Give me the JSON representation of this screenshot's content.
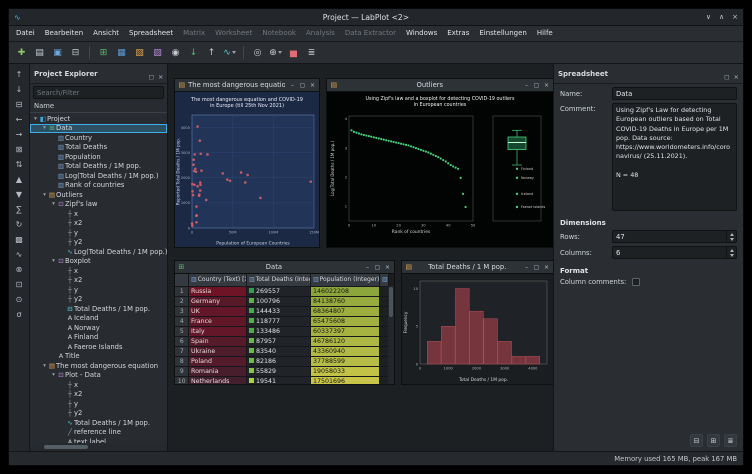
{
  "window": {
    "title": "Project — LabPlot <2>",
    "app_icon_glyph": "∿",
    "controls": [
      {
        "name": "minimize-button",
        "glyph": "∨"
      },
      {
        "name": "maximize-button",
        "glyph": "∧"
      },
      {
        "name": "close-button",
        "glyph": "×"
      }
    ],
    "dock_buttons": [
      {
        "name": "float-dock-button",
        "glyph": "◻"
      },
      {
        "name": "close-dock-button",
        "glyph": "×"
      }
    ],
    "status_memory": "Memory used 165 MB, peak 167 MB"
  },
  "menu": {
    "items": [
      {
        "label": "Datei"
      },
      {
        "label": "Bearbeiten"
      },
      {
        "label": "Ansicht"
      },
      {
        "label": "Spreadsheet"
      },
      {
        "label": "Matrix",
        "disabled": true
      },
      {
        "label": "Worksheet",
        "disabled": true
      },
      {
        "label": "Notebook",
        "disabled": true
      },
      {
        "label": "Analysis",
        "disabled": true
      },
      {
        "label": "Data Extractor",
        "disabled": true
      },
      {
        "label": "Windows"
      },
      {
        "label": "Extras"
      },
      {
        "label": "Einstellungen"
      },
      {
        "label": "Hilfe"
      }
    ]
  },
  "toolbar": {
    "buttons": [
      {
        "name": "new-project",
        "glyph": "✚",
        "color": "#8fc76a"
      },
      {
        "name": "open-project",
        "glyph": "▤",
        "color": "#c7ccd1"
      },
      {
        "name": "save-project",
        "glyph": "▣",
        "color": "#6fa8dc"
      },
      {
        "name": "print",
        "glyph": "⊟",
        "color": "#c7ccd1"
      },
      {
        "sep": true
      },
      {
        "name": "new-spreadsheet",
        "glyph": "⊞",
        "color": "#57b86b"
      },
      {
        "name": "new-matrix",
        "glyph": "▦",
        "color": "#5b9bd5"
      },
      {
        "name": "new-worksheet",
        "glyph": "▧",
        "color": "#e0a24b"
      },
      {
        "name": "new-notebook",
        "glyph": "▨",
        "color": "#b98bd6"
      },
      {
        "name": "new-datapicker",
        "glyph": "◉",
        "color": "#c7ccd1"
      },
      {
        "name": "import-data",
        "glyph": "↓",
        "color": "#57b86b"
      },
      {
        "name": "export-data",
        "glyph": "↑",
        "color": "#c7ccd1"
      },
      {
        "name": "new-plot",
        "glyph": "∿",
        "color": "#5bc8d9",
        "dropdown": true
      },
      {
        "sep": true
      },
      {
        "name": "navigate-mode",
        "glyph": "◎",
        "color": "#c7ccd1"
      },
      {
        "name": "zoom-mode",
        "glyph": "⊕",
        "color": "#c7ccd1",
        "dropdown": true
      },
      {
        "name": "add-chart",
        "glyph": "▅",
        "color": "#e06c75"
      },
      {
        "name": "presenter-mode",
        "glyph": "≣",
        "color": "#c7ccd1"
      }
    ]
  },
  "left_toolbar": {
    "buttons": [
      {
        "name": "insert-row-above",
        "glyph": "↑"
      },
      {
        "name": "insert-row-below",
        "glyph": "↓"
      },
      {
        "name": "remove-rows",
        "glyph": "⊟"
      },
      {
        "name": "insert-column-left",
        "glyph": "←"
      },
      {
        "name": "insert-column-right",
        "glyph": "→"
      },
      {
        "name": "remove-columns",
        "glyph": "⊠"
      },
      {
        "name": "sort",
        "glyph": "⇅"
      },
      {
        "name": "sort-ascending",
        "glyph": "▲"
      },
      {
        "name": "sort-descending",
        "glyph": "▼"
      },
      {
        "name": "statistics",
        "glyph": "∑"
      },
      {
        "name": "recalculate",
        "glyph": "↻"
      },
      {
        "name": "mask-values",
        "glyph": "▩"
      },
      {
        "name": "plot-data",
        "glyph": "∿"
      },
      {
        "name": "clear-spreadsheet",
        "glyph": "⊗"
      },
      {
        "name": "go-to-cell",
        "glyph": "⊡"
      },
      {
        "name": "search",
        "glyph": "⊙"
      },
      {
        "name": "column-statistics",
        "glyph": "σ"
      }
    ]
  },
  "project_explorer": {
    "title": "Project Explorer",
    "search_placeholder": "Search/Filter",
    "name_header": "Name",
    "tree": [
      {
        "label": "Project",
        "depth": 0,
        "icon": "project",
        "expanded": true
      },
      {
        "label": "Data",
        "depth": 1,
        "icon": "spreadsheet",
        "expanded": true,
        "selected": true
      },
      {
        "label": "Country",
        "depth": 2,
        "icon": "column"
      },
      {
        "label": "Total Deaths",
        "depth": 2,
        "icon": "column"
      },
      {
        "label": "Population",
        "depth": 2,
        "icon": "column"
      },
      {
        "label": "Total Deaths / 1M pop.",
        "depth": 2,
        "icon": "column"
      },
      {
        "label": "Log(Total Deaths / 1M pop.)",
        "depth": 2,
        "icon": "column"
      },
      {
        "label": "Rank of countries",
        "depth": 2,
        "icon": "column"
      },
      {
        "label": "Outliers",
        "depth": 1,
        "icon": "worksheet",
        "expanded": true
      },
      {
        "label": "Zipf's law",
        "depth": 2,
        "icon": "plot",
        "expanded": true
      },
      {
        "label": "x",
        "depth": 3,
        "icon": "axis"
      },
      {
        "label": "x2",
        "depth": 3,
        "icon": "axis"
      },
      {
        "label": "y",
        "depth": 3,
        "icon": "axis"
      },
      {
        "label": "y2",
        "depth": 3,
        "icon": "axis"
      },
      {
        "label": "Log(Total Deaths / 1M pop.)",
        "depth": 3,
        "icon": "curve"
      },
      {
        "label": "Boxplot",
        "depth": 2,
        "icon": "plot",
        "expanded": true
      },
      {
        "label": "x",
        "depth": 3,
        "icon": "axis"
      },
      {
        "label": "x2",
        "depth": 3,
        "icon": "axis"
      },
      {
        "label": "y",
        "depth": 3,
        "icon": "axis"
      },
      {
        "label": "y2",
        "depth": 3,
        "icon": "axis"
      },
      {
        "label": "Total Deaths / 1M pop.",
        "depth": 3,
        "icon": "boxplot"
      },
      {
        "label": "Iceland",
        "depth": 3,
        "icon": "textlabel"
      },
      {
        "label": "Norway",
        "depth": 3,
        "icon": "textlabel"
      },
      {
        "label": "Finland",
        "depth": 3,
        "icon": "textlabel"
      },
      {
        "label": "Faeroe Islands",
        "depth": 3,
        "icon": "textlabel"
      },
      {
        "label": "Title",
        "depth": 2,
        "icon": "textlabel"
      },
      {
        "label": "The most dangerous equation",
        "depth": 1,
        "icon": "worksheet",
        "expanded": true
      },
      {
        "label": "Plot - Data",
        "depth": 2,
        "icon": "plot",
        "expanded": true
      },
      {
        "label": "x",
        "depth": 3,
        "icon": "axis"
      },
      {
        "label": "x2",
        "depth": 3,
        "icon": "axis"
      },
      {
        "label": "y",
        "depth": 3,
        "icon": "axis"
      },
      {
        "label": "y2",
        "depth": 3,
        "icon": "axis"
      },
      {
        "label": "Total Deaths / 1M pop.",
        "depth": 3,
        "icon": "curve"
      },
      {
        "label": "reference line",
        "depth": 3,
        "icon": "refline"
      },
      {
        "label": "text label",
        "depth": 3,
        "icon": "textlabel"
      }
    ]
  },
  "mdi": {
    "window_buttons": [
      {
        "name": "minimize-window-button",
        "glyph": "–"
      },
      {
        "name": "restore-window-button",
        "glyph": "▢"
      },
      {
        "name": "close-window-button",
        "glyph": "×"
      }
    ],
    "equation_window": {
      "title": "The most dangerous equation",
      "icon_glyph": "▤"
    },
    "outliers_window": {
      "title": "Outliers",
      "icon_glyph": "▤"
    },
    "histogram_window": {
      "title": "Total Deaths / 1 M pop.",
      "icon_glyph": "▤"
    },
    "data_window": {
      "title": "Data",
      "icon_glyph": "⊞",
      "header_icon_glyph": "▥",
      "columns": [
        "Country (Text) [X]",
        "Total Deaths (Integer) [Y]",
        "Population (Integer) [Y]"
      ],
      "rows": [
        {
          "n": "1",
          "country": "Russia",
          "deaths": "269557",
          "population": "146022208",
          "country_bg": "#6e1426",
          "pop_bg": "#8da63c",
          "deaths_sq": "#2f9e4f"
        },
        {
          "n": "2",
          "country": "Germany",
          "deaths": "100796",
          "population": "84138760",
          "country_bg": "#581a29",
          "pop_bg": "#96aa3e",
          "deaths_sq": "#5ab447"
        },
        {
          "n": "3",
          "country": "UK",
          "deaths": "144433",
          "population": "68364807",
          "country_bg": "#641728",
          "pop_bg": "#9dae3f",
          "deaths_sq": "#46ab4b"
        },
        {
          "n": "4",
          "country": "France",
          "deaths": "118777",
          "population": "65475608",
          "country_bg": "#601828",
          "pop_bg": "#a1b040",
          "deaths_sq": "#50b049"
        },
        {
          "n": "5",
          "country": "Italy",
          "deaths": "133486",
          "population": "60337397",
          "country_bg": "#631728",
          "pop_bg": "#a6b341",
          "deaths_sq": "#4aad4a"
        },
        {
          "n": "6",
          "country": "Spain",
          "deaths": "87957",
          "population": "46786120",
          "country_bg": "#551b2a",
          "pop_bg": "#adb743",
          "deaths_sq": "#66ba45"
        },
        {
          "n": "7",
          "country": "Ukraine",
          "deaths": "83540",
          "population": "43360940",
          "country_bg": "#4e1d2b",
          "pop_bg": "#b1ba44",
          "deaths_sq": "#6bbc44"
        },
        {
          "n": "8",
          "country": "Poland",
          "deaths": "82186",
          "population": "37788599",
          "country_bg": "#541b2a",
          "pop_bg": "#b6bc45",
          "deaths_sq": "#6dbd44"
        },
        {
          "n": "9",
          "country": "Romania",
          "deaths": "55829",
          "population": "19058033",
          "country_bg": "#481e2c",
          "pop_bg": "#c2c247",
          "deaths_sq": "#84c641"
        },
        {
          "n": "10",
          "country": "Netherlands",
          "deaths": "19541",
          "population": "17501696",
          "country_bg": "#431f2d",
          "pop_bg": "#c8c548",
          "deaths_sq": "#a8d43d"
        }
      ]
    }
  },
  "properties": {
    "dock_title": "Spreadsheet",
    "name_label": "Name:",
    "name_value": "Data",
    "comment_label": "Comment:",
    "comment_value": "Using Zipf's Law for detecting European outliers based on Total COVID-19 Deaths in Europe per 1M pop. Data source: https://www.worldometers.info/coronavirus/ (25.11.2021).\n\nN = 48",
    "dimensions_label": "Dimensions",
    "rows_label": "Rows:",
    "rows_value": "47",
    "columns_label": "Columns:",
    "columns_value": "6",
    "format_label": "Format",
    "column_comments_label": "Column comments:",
    "footer_buttons": [
      {
        "name": "collapse-all-button",
        "glyph": "⊟"
      },
      {
        "name": "expand-all-button",
        "glyph": "⊞"
      },
      {
        "name": "more-options-button",
        "glyph": "≣"
      }
    ]
  },
  "chart_data": [
    {
      "id": "equation",
      "type": "scatter",
      "title": "The most dangerous equation and COVID-19 in Europe (till 25th Nov 2021)",
      "title_lines": [
        "The most dangerous equation and COVID-19",
        "in Europe (till 25th Nov 2021)"
      ],
      "xlabel": "Population of European Countries",
      "ylabel": "Reported Total Deaths / 1M pop.",
      "xlim": [
        0,
        150000000
      ],
      "ylim": [
        0,
        4500
      ],
      "xticks": [
        0,
        50000000,
        100000000,
        150000000
      ],
      "xtick_labels": [
        "0",
        "50M",
        "100M",
        "150M"
      ],
      "yticks": [
        0,
        1000,
        2000,
        3000,
        4000
      ],
      "grid": true,
      "legend": "none",
      "point_color": "#e0606a",
      "x": [
        146022208,
        84138760,
        68364807,
        65475608,
        60337397,
        46786120,
        43360940,
        37788599,
        19058033,
        17501696,
        11673070,
        10724555,
        10370747,
        10167925,
        10099270,
        9634164,
        8933346,
        8697723,
        6896663,
        6844597,
        5793636,
        5548361,
        5456681,
        5415943,
        4984209,
        4036355,
        3280815,
        2968398,
        2872933,
        2078657,
        1883008,
        1325188,
        625978,
        441543,
        366425,
        38250
      ],
      "y": [
        1846,
        1198,
        2113,
        1814,
        2212,
        1880,
        1926,
        2175,
        2929,
        1117,
        2284,
        2957,
        1717,
        1810,
        1490,
        3478,
        1334,
        1285,
        4038,
        1660,
        502,
        227,
        855,
        489,
        2240,
        2360,
        2930,
        1720,
        2270,
        2720,
        2520,
        1310,
        1460,
        1750,
        96,
        180
      ]
    },
    {
      "id": "zipf",
      "type": "scatter",
      "title": "Using Zipf's law and a boxplot for detecting COVID-19 outliers in European countries",
      "title_lines": [
        "Using Zipf's law and a boxplot for detecting COVID-19 outliers",
        "in European countries"
      ],
      "xlabel": "Rank of countries",
      "ylabel": "Log(Total Deaths / 1M pop.)",
      "xlim": [
        0,
        50
      ],
      "ylim": [
        0.5,
        4.1
      ],
      "xticks": [
        0,
        10,
        20,
        30,
        40,
        50
      ],
      "yticks": [
        1,
        2,
        3,
        4
      ],
      "grid": false,
      "point_color": "#45d17c",
      "x": [
        1,
        2,
        3,
        4,
        5,
        6,
        7,
        8,
        9,
        10,
        11,
        12,
        13,
        14,
        15,
        16,
        17,
        18,
        19,
        20,
        21,
        22,
        23,
        24,
        25,
        26,
        27,
        28,
        29,
        30,
        31,
        32,
        33,
        34,
        35,
        36,
        37,
        38,
        39,
        40,
        41,
        42,
        43,
        44,
        45,
        46,
        47
      ],
      "y": [
        3.61,
        3.56,
        3.53,
        3.5,
        3.47,
        3.45,
        3.43,
        3.41,
        3.39,
        3.37,
        3.35,
        3.33,
        3.31,
        3.29,
        3.27,
        3.25,
        3.23,
        3.21,
        3.19,
        3.17,
        3.15,
        3.13,
        3.11,
        3.09,
        3.06,
        3.03,
        3.0,
        2.97,
        2.94,
        2.91,
        2.88,
        2.85,
        2.81,
        2.77,
        2.73,
        2.69,
        2.64,
        2.59,
        2.54,
        2.48,
        2.42,
        2.37,
        2.33,
        2.29,
        1.98,
        1.43,
        0.98
      ]
    },
    {
      "id": "outlier-box",
      "type": "boxplot",
      "ylim": [
        0.5,
        4.1
      ],
      "min": 2.42,
      "q1": 2.95,
      "median": 3.19,
      "q3": 3.38,
      "max": 3.61,
      "outliers": [
        2.29,
        1.98,
        1.43,
        0.98
      ],
      "outlier_labels": [
        "Finland",
        "Norway",
        "Iceland",
        "Faeroe Islands"
      ],
      "box_color": "#45d17c"
    },
    {
      "id": "histogram",
      "type": "bar",
      "xlabel": "Total Deaths / 1M pop.",
      "ylabel": "Frequency",
      "xlim": [
        0,
        4500
      ],
      "ylim": [
        0,
        11
      ],
      "xticks": [
        0,
        1000,
        2000,
        3000,
        4000
      ],
      "yticks": [
        0,
        5,
        10
      ],
      "bin_edges": [
        250,
        750,
        1250,
        1750,
        2250,
        2750,
        3250,
        3750,
        4250
      ],
      "values": [
        3,
        5,
        10,
        7,
        6,
        3,
        1,
        1
      ],
      "bar_color": "#76343c",
      "bar_border": "#b3525c"
    }
  ]
}
